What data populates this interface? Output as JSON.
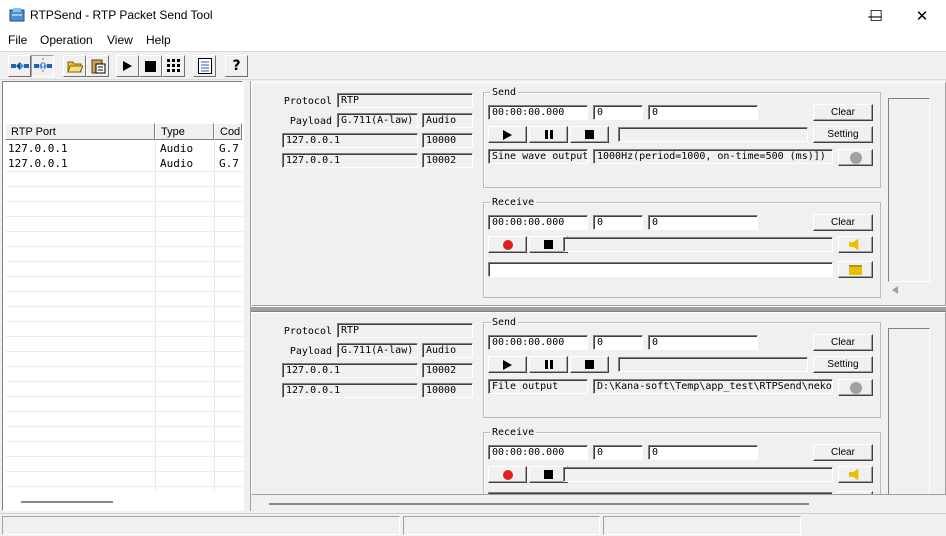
{
  "window": {
    "title": "RTPSend - RTP Packet Send Tool",
    "minimize": "—",
    "maximize": "☐",
    "close": "✕"
  },
  "menu": [
    "File",
    "Operation",
    "View",
    "Help"
  ],
  "toolbar": {
    "icons": [
      "connect-icon",
      "disconnect-icon",
      "open-folder-icon",
      "paste-icon",
      "play-icon",
      "stop-icon",
      "grid-icon",
      "list-icon",
      "help-icon"
    ],
    "help_label": "?"
  },
  "list": {
    "columns": [
      "RTP Port",
      "Type",
      "Cod"
    ],
    "rows": [
      {
        "port": "127.0.0.1",
        "type": "Audio",
        "codec": "G.7"
      },
      {
        "port": "127.0.0.1",
        "type": "Audio",
        "codec": "G.7"
      }
    ]
  },
  "channels": [
    {
      "protocol_label": "Protocol",
      "protocol": "RTP",
      "payload_label": "Payload",
      "payload": "G.711(A-law)",
      "media": "Audio",
      "local_ip": "127.0.0.1",
      "local_port": "10000",
      "remote_ip": "127.0.0.1",
      "remote_port": "10002",
      "send": {
        "title": "Send",
        "time": "00:00:00.000",
        "count1": "0",
        "count2": "0",
        "clear": "Clear",
        "setting": "Setting",
        "source_type": "Sine wave output",
        "source_detail": "1000Hz(period=1000, on-time=500 (ms)])"
      },
      "receive": {
        "title": "Receive",
        "time": "00:00:00.000",
        "count1": "0",
        "count2": "0",
        "clear": "Clear",
        "file": ""
      }
    },
    {
      "protocol_label": "Protocol",
      "protocol": "RTP",
      "payload_label": "Payload",
      "payload": "G.711(A-law)",
      "media": "Audio",
      "local_ip": "127.0.0.1",
      "local_port": "10002",
      "remote_ip": "127.0.0.1",
      "remote_port": "10000",
      "send": {
        "title": "Send",
        "time": "00:00:00.000",
        "count1": "0",
        "count2": "0",
        "clear": "Clear",
        "setting": "Setting",
        "source_type": "File output",
        "source_detail": "D:\\Kana-soft\\Temp\\app_test\\RTPSend\\neko"
      },
      "receive": {
        "title": "Receive",
        "time": "00:00:00.000",
        "count1": "0",
        "count2": "0",
        "clear": "Clear",
        "file": ""
      }
    }
  ],
  "status": {
    "panes": [
      "",
      "",
      ""
    ]
  }
}
